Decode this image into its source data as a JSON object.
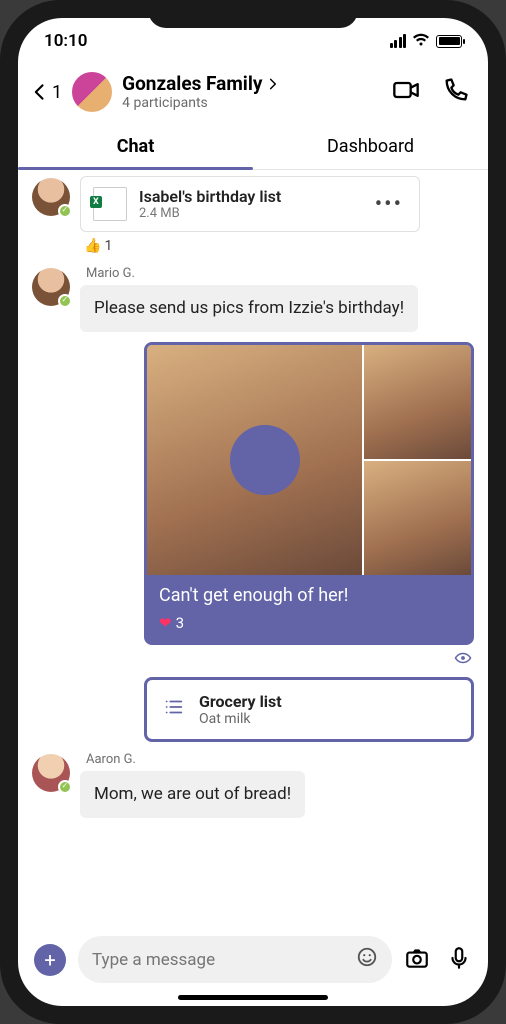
{
  "status": {
    "time": "10:10"
  },
  "header": {
    "back_count": "1",
    "chat_title": "Gonzales Family",
    "subtitle": "4 participants"
  },
  "tabs": {
    "chat": "Chat",
    "dashboard": "Dashboard"
  },
  "file_attachment": {
    "name": "Isabel's birthday list",
    "meta": "2.4 MB",
    "badge": "X",
    "reaction_icon": "👍",
    "reaction_count": "1"
  },
  "messages": {
    "m1": {
      "sender": "Mario G.",
      "text": "Please send us pics from Izzie's birthday!"
    },
    "m2": {
      "caption": "Can't get enough of her!",
      "reaction_icon": "❤",
      "reaction_count": "3"
    },
    "task": {
      "title": "Grocery list",
      "subtitle": "Oat milk"
    },
    "m3": {
      "sender": "Aaron G.",
      "text": "Mom, we are out of bread!"
    }
  },
  "composer": {
    "placeholder": "Type a message"
  }
}
